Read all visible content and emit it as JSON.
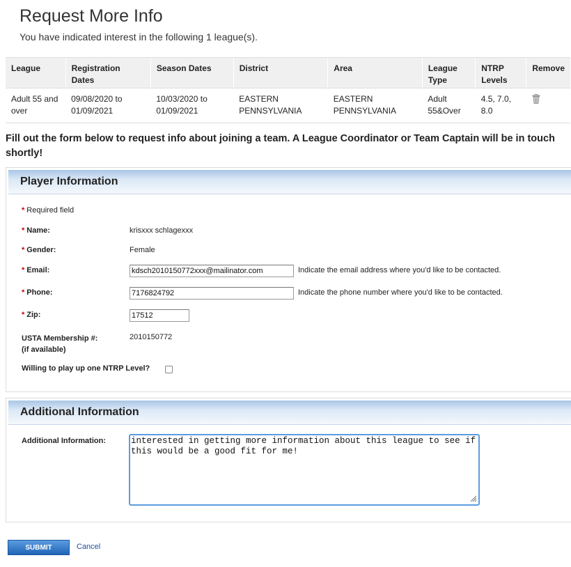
{
  "page": {
    "title": "Request More Info",
    "intro": "You have indicated interest in the following 1 league(s).",
    "form_intro": "Fill out the form below to request info about joining a team. A League Coordinator or Team Captain will be in touch shortly!"
  },
  "leagues_table": {
    "headers": [
      "League",
      "Registration Dates",
      "Season Dates",
      "District",
      "Area",
      "League Type",
      "NTRP Levels",
      "Remove"
    ],
    "rows": [
      {
        "league": "Adult 55 and over",
        "registration_dates": "09/08/2020 to 01/09/2021",
        "season_dates": "10/03/2020 to 01/09/2021",
        "district": "EASTERN PENNSYLVANIA",
        "area": "EASTERN PENNSYLVANIA",
        "league_type": "Adult 55&Over",
        "ntrp_levels": "4.5, 7.0, 8.0",
        "remove_icon": "trash-icon"
      }
    ]
  },
  "player_info": {
    "section_title": "Player Information",
    "required_note": "Required field",
    "name_label": "Name:",
    "name_value": "krisxxx schlagexxx",
    "gender_label": "Gender:",
    "gender_value": "Female",
    "email_label": "Email:",
    "email_value": "kdsch2010150772xxx@mailinator.com",
    "email_hint": "Indicate the email address where you'd like to be contacted.",
    "phone_label": "Phone:",
    "phone_value": "7176824792",
    "phone_hint": "Indicate the phone number where you'd like to be contacted.",
    "zip_label": "Zip:",
    "zip_value": "17512",
    "membership_label": "USTA Membership #:",
    "membership_sublabel": "(if available)",
    "membership_value": "2010150772",
    "play_up_label": "Willing to play up one NTRP Level?",
    "play_up_checked": false
  },
  "additional_info": {
    "section_title": "Additional Information",
    "label": "Additional Information:",
    "value": "interested in getting more information about this league to see if this would be a good fit for me!"
  },
  "actions": {
    "submit_label": "SUBMIT",
    "cancel_label": "Cancel"
  },
  "colors": {
    "required_asterisk": "#cc0000",
    "link": "#1a4fa0",
    "submit_bg": "#1f65b6",
    "panel_header": "#a9c6e6"
  }
}
